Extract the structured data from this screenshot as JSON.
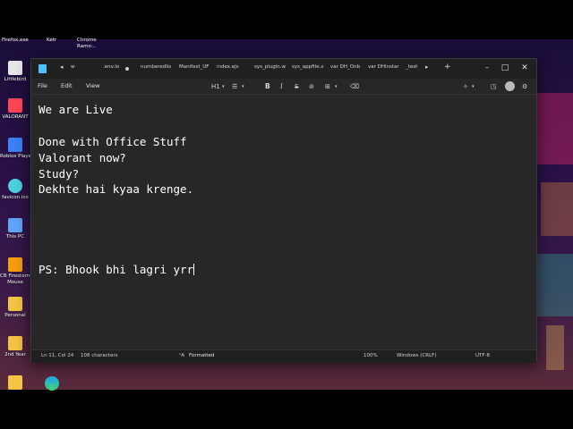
{
  "top_labels": [
    "Firefox.exe",
    "Ketr",
    "Chrome",
    "Ramo..."
  ],
  "desktop_icons": [
    {
      "label": "Littlebird",
      "icon": "bird-app-icon",
      "color": "#e8e8e8"
    },
    {
      "label": "VALORANT",
      "icon": "valorant-icon",
      "color": "#ff4655"
    },
    {
      "label": "Roblox Player",
      "icon": "roblox-icon",
      "color": "#3b82f6"
    },
    {
      "label": "favicon.ico",
      "icon": "favicon-icon",
      "color": "#4dd0e1"
    },
    {
      "label": "This PC",
      "icon": "computer-icon",
      "color": "#60a5fa"
    },
    {
      "label": "CB Firestorm",
      "icon": "firestorm-icon",
      "color": "#f59e0b"
    },
    {
      "label": "Mouse",
      "icon": "",
      "color": ""
    },
    {
      "label": "Personal",
      "icon": "folder-icon",
      "color": "#f6c445"
    },
    {
      "label": "2nd Year",
      "icon": "folder-icon",
      "color": "#f6c445"
    }
  ],
  "window": {
    "tabs": [
      ".env.lo",
      "numberedlis",
      "Manifest_UF",
      "index.ejs",
      "sys_plugin.w",
      "sys_appfile.x",
      "var DH_Onb",
      "var DHinstar",
      "_test"
    ],
    "first_tab": "w",
    "add_tab": "+",
    "controls": {
      "minimize": "–",
      "maximize": "□",
      "close": "✕"
    }
  },
  "menu": {
    "file": "File",
    "edit": "Edit",
    "view": "View"
  },
  "toolbar": {
    "heading": "H1",
    "list": "☰",
    "bold": "B",
    "italic": "I",
    "strike": "S",
    "link": "⊘",
    "table": "⊞",
    "clear": "⌫"
  },
  "editor": {
    "lines": [
      "We are Live",
      "",
      "Done with Office Stuff",
      "Valorant now?",
      "Study?",
      "Dekhte hai kyaa krenge.",
      "",
      "",
      "",
      "",
      "PS: Bhook bhi lagri yrr"
    ]
  },
  "status": {
    "position": "Ln 11, Col 24",
    "chars": "108 characters",
    "format": "Formatted",
    "zoom": "100%",
    "line_ending": "Windows (CRLF)",
    "encoding": "UTF-8"
  }
}
